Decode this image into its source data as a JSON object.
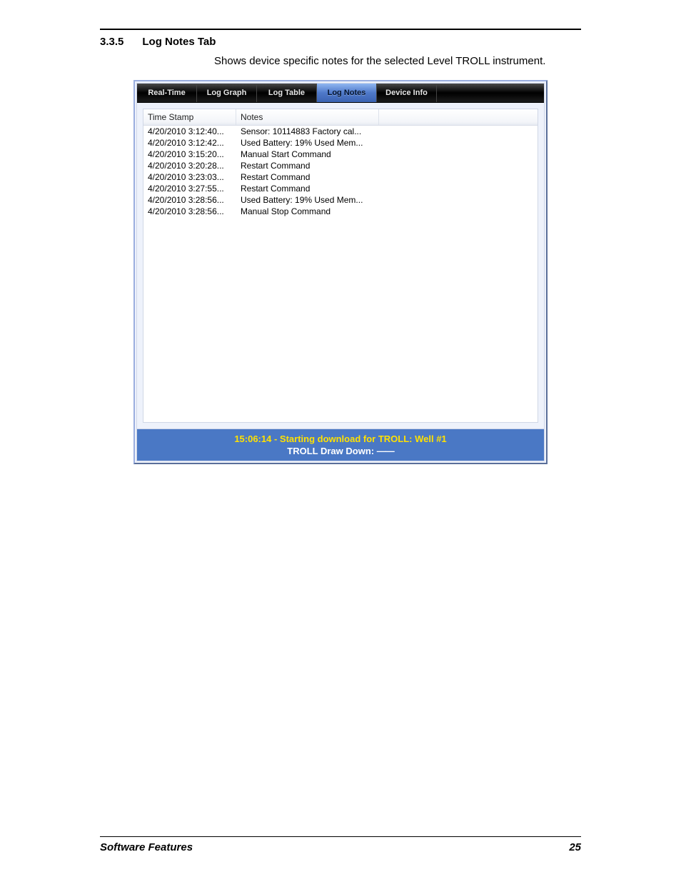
{
  "section": {
    "number": "3.3.5",
    "title": "Log Notes Tab",
    "description": "Shows device specific notes for the selected Level TROLL instrument."
  },
  "tabs": [
    {
      "label": "Real-Time",
      "active": false
    },
    {
      "label": "Log Graph",
      "active": false
    },
    {
      "label": "Log Table",
      "active": false
    },
    {
      "label": "Log Notes",
      "active": true
    },
    {
      "label": "Device Info",
      "active": false
    }
  ],
  "columns": {
    "timestamp": "Time Stamp",
    "notes": "Notes"
  },
  "rows": [
    {
      "ts": "4/20/2010 3:12:40...",
      "note": "Sensor: 10114883  Factory cal..."
    },
    {
      "ts": "4/20/2010 3:12:42...",
      "note": "Used Battery: 19% Used Mem..."
    },
    {
      "ts": "4/20/2010 3:15:20...",
      "note": "Manual Start Command"
    },
    {
      "ts": "4/20/2010 3:20:28...",
      "note": "Restart Command"
    },
    {
      "ts": "4/20/2010 3:23:03...",
      "note": "Restart Command"
    },
    {
      "ts": "4/20/2010 3:27:55...",
      "note": "Restart Command"
    },
    {
      "ts": "4/20/2010 3:28:56...",
      "note": "Used Battery: 19% Used Mem..."
    },
    {
      "ts": "4/20/2010 3:28:56...",
      "note": "Manual Stop Command"
    }
  ],
  "status": {
    "line1": "15:06:14 - Starting download for TROLL: Well #1",
    "line2_prefix": "TROLL Draw Down: ",
    "line2_dash": "——"
  },
  "footer": {
    "left": "Software Features",
    "right": "25"
  }
}
